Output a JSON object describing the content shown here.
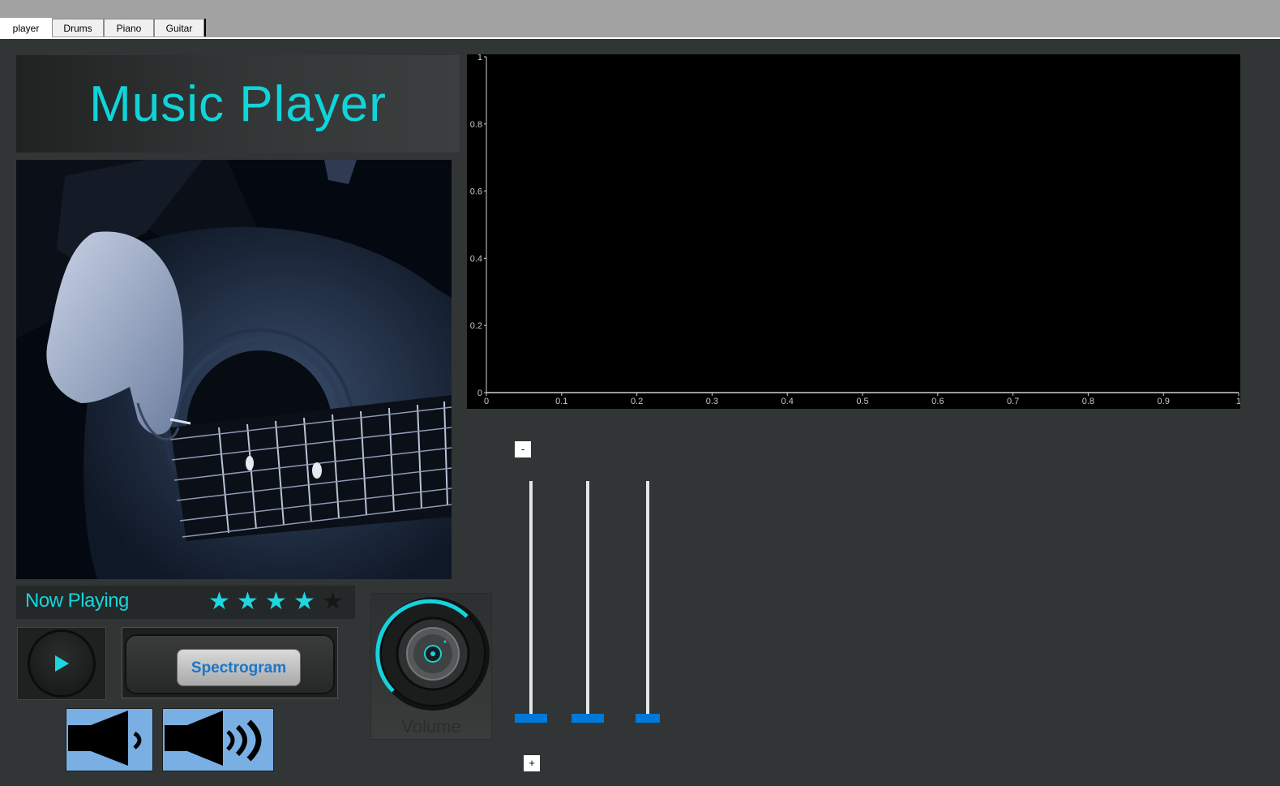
{
  "tabs": [
    {
      "label": "player",
      "active": true
    },
    {
      "label": "Drums",
      "active": false
    },
    {
      "label": "Piano",
      "active": false
    },
    {
      "label": "Guitar",
      "active": false
    }
  ],
  "banner": {
    "title": "Music Player",
    "title_color": "#0fd4d9"
  },
  "now_playing": {
    "label": "Now Playing",
    "rating": 4,
    "rating_max": 5,
    "star_color": "#1ed6df"
  },
  "controls": {
    "play_icon": "play-icon",
    "spectrogram_label": "Spectrogram",
    "volume_down_icon": "speaker-low-icon",
    "volume_up_icon": "speaker-high-icon",
    "volume_knob_label": "Volume",
    "accent": "#0078d7"
  },
  "sliders": {
    "minus_label": "-",
    "plus_label": "+",
    "count": 3,
    "values": [
      0,
      0,
      0
    ]
  },
  "chart_data": {
    "type": "line",
    "series": [],
    "x_ticks": [
      "0",
      "0.1",
      "0.2",
      "0.3",
      "0.4",
      "0.5",
      "0.6",
      "0.7",
      "0.8",
      "0.9",
      "1"
    ],
    "y_ticks": [
      "0",
      "0.2",
      "0.4",
      "0.6",
      "0.8",
      "1"
    ],
    "xlim": [
      0,
      1
    ],
    "ylim": [
      0,
      1
    ],
    "background": "#000000",
    "grid": false
  }
}
